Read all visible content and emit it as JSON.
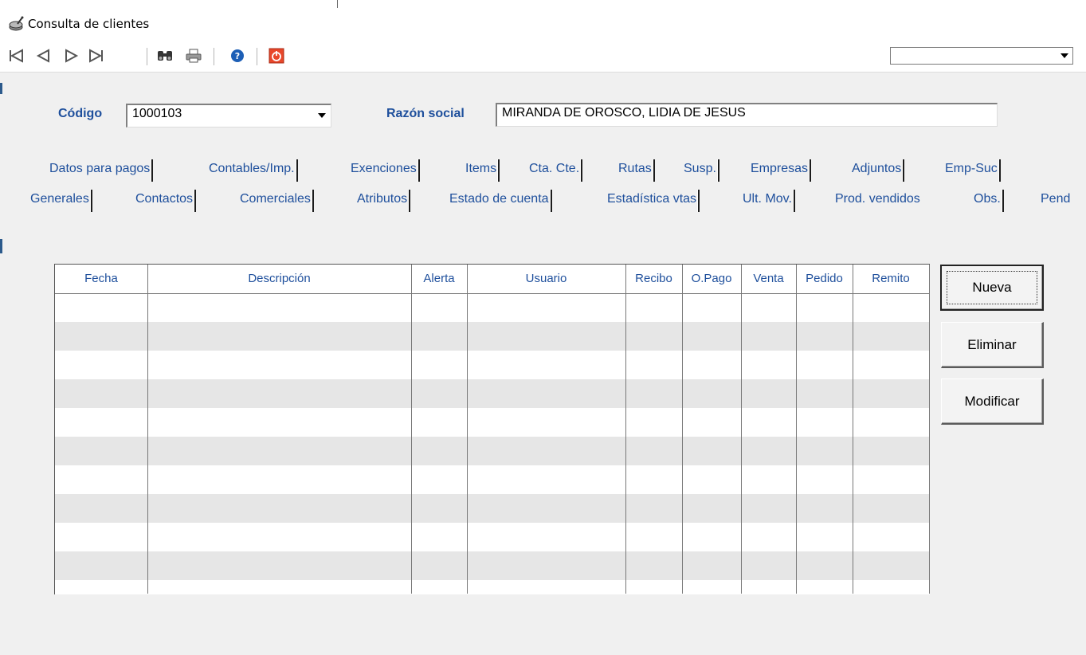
{
  "window": {
    "title": "Consulta de clientes",
    "icon": "database-icon"
  },
  "toolbar": {
    "buttons": [
      "first-record-icon",
      "previous-record-icon",
      "next-record-icon",
      "last-record-icon",
      "binoculars-search-icon",
      "print-icon",
      "help-icon",
      "exit-power-icon"
    ],
    "combo_value": ""
  },
  "header": {
    "codigo_label": "Código",
    "codigo_value": "1000103",
    "razon_label": "Razón social",
    "razon_value": "MIRANDA DE OROSCO, LIDIA DE JESUS"
  },
  "tabs_row1": [
    "Datos para pagos",
    "Contables/Imp.",
    "Exenciones",
    "Items",
    "Cta. Cte.",
    "Rutas",
    "Susp.",
    "Empresas",
    "Adjuntos",
    "Emp-Suc"
  ],
  "tabs_row2": [
    "Generales",
    "Contactos",
    "Comerciales",
    "Atributos",
    "Estado de cuenta",
    "Estadística vtas",
    "Ult. Mov.",
    "Prod. vendidos",
    "Obs.",
    "Pend"
  ],
  "active_tab": "Obs.",
  "grid": {
    "columns": [
      "Fecha",
      "Descripción",
      "Alerta",
      "Usuario",
      "Recibo",
      "O.Pago",
      "Venta",
      "Pedido",
      "Remito"
    ],
    "rows": []
  },
  "buttons": {
    "nueva": "Nueva",
    "eliminar": "Eliminar",
    "modificar": "Modificar"
  },
  "colors": {
    "label_blue": "#1e4f9c",
    "row_alt": "#e6e6e6",
    "background": "#f0f0f0"
  }
}
